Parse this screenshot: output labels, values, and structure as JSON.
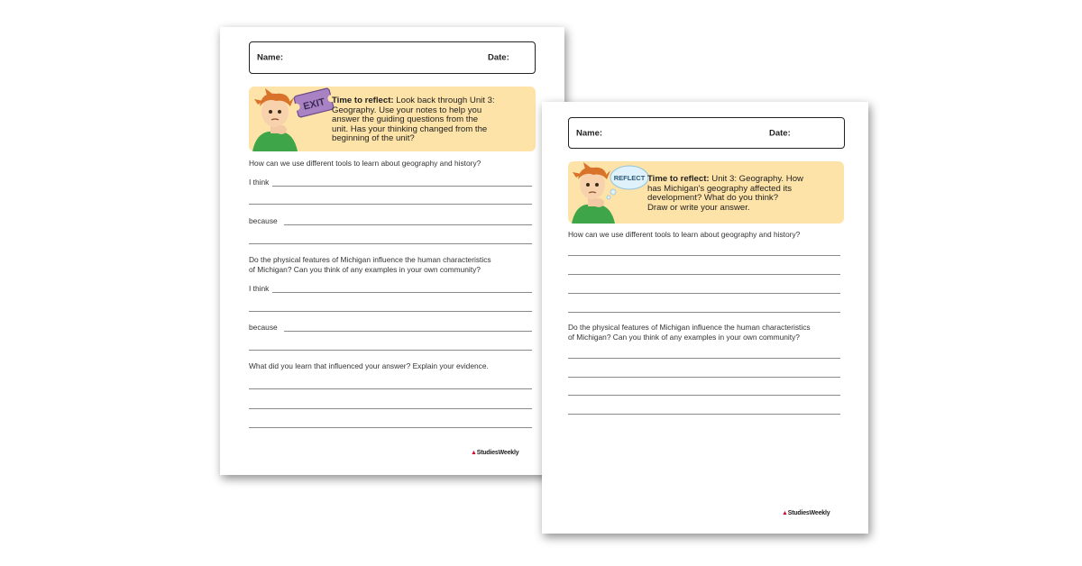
{
  "sheet1": {
    "name_label": "Name:",
    "date_label": "Date:",
    "sign_text": "EXIT",
    "reflect_heading": "Time to reflect:",
    "reflect_lines": [
      "Look back through Unit 3:",
      "Geography. Use your notes to help you",
      "answer the guiding questions from the",
      "unit. Has your thinking changed from the",
      "beginning of the unit?"
    ],
    "q1": "How can we use different tools to learn about geography and history?",
    "i_think": "I think",
    "because": "because",
    "q2_lines": [
      "Do the physical features of Michigan influence the human characteristics",
      "of Michigan? Can you think of any examples in your own community?"
    ],
    "q3": "What did you learn that influenced your answer? Explain your evidence.",
    "logo_text": "StudiesWeekly"
  },
  "sheet2": {
    "name_label": "Name:",
    "date_label": "Date:",
    "bubble_text": "REFLECT",
    "reflect_heading": "Time to reflect:",
    "reflect_lines": [
      "Unit 3: Geography. How",
      "has Michigan's geography affected its",
      "development? What do you think?",
      "Draw or write your answer."
    ],
    "q1": "How can we use different tools to learn about geography and history?",
    "q2_lines": [
      "Do the physical features of Michigan influence the human characteristics",
      "of Michigan? Can you think of any examples in your own community?"
    ],
    "logo_text": "StudiesWeekly"
  },
  "colors": {
    "banner": "#fde3a7",
    "hair": "#d9732b",
    "shirt": "#3ea548",
    "exit_sign": "#a982c4",
    "logo_red": "#c8102e"
  }
}
